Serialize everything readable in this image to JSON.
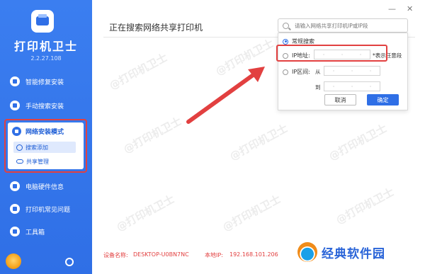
{
  "app": {
    "title": "打印机卫士",
    "version": "2.2.27.108"
  },
  "sidebar": {
    "items": [
      {
        "label": "智能修复安装",
        "icon": "repair-icon"
      },
      {
        "label": "手动搜索安装",
        "icon": "manual-search-icon"
      },
      {
        "label": "网络安装模式",
        "icon": "network-icon"
      },
      {
        "label": "电脑硬件信息",
        "icon": "hardware-icon"
      },
      {
        "label": "打印机常见问题",
        "icon": "faq-icon"
      },
      {
        "label": "工具箱",
        "icon": "toolbox-icon"
      }
    ],
    "sub_items": [
      {
        "label": "搜索添加",
        "icon": "search-add-icon"
      },
      {
        "label": "共享管理",
        "icon": "cloud-icon"
      }
    ]
  },
  "window": {
    "minimize": "—",
    "close": "✕"
  },
  "main": {
    "title": "正在搜索网络共享打印机"
  },
  "search": {
    "placeholder": "请输入网络共享打印机IP或IP段"
  },
  "dropdown": {
    "option_normal": "常规搜索",
    "option_ip": "IP地址:",
    "ip_hint": "*表示任意段",
    "option_range": "IP区间:",
    "range_from": "从",
    "range_to": "到",
    "ip_dot": "·",
    "cancel": "取消",
    "confirm": "确定"
  },
  "footer": {
    "device_label": "设备名称:",
    "device_name": "DESKTOP-U0BN7NC",
    "ip_label": "本地IP:",
    "ip_value": "192.168.101.206"
  },
  "watermark": "@打印机卫士",
  "brand": {
    "text": "经典软件园"
  },
  "colors": {
    "sidebar": "#2f6fe6",
    "highlight": "#e24040",
    "accent": "#2f6fe6"
  }
}
